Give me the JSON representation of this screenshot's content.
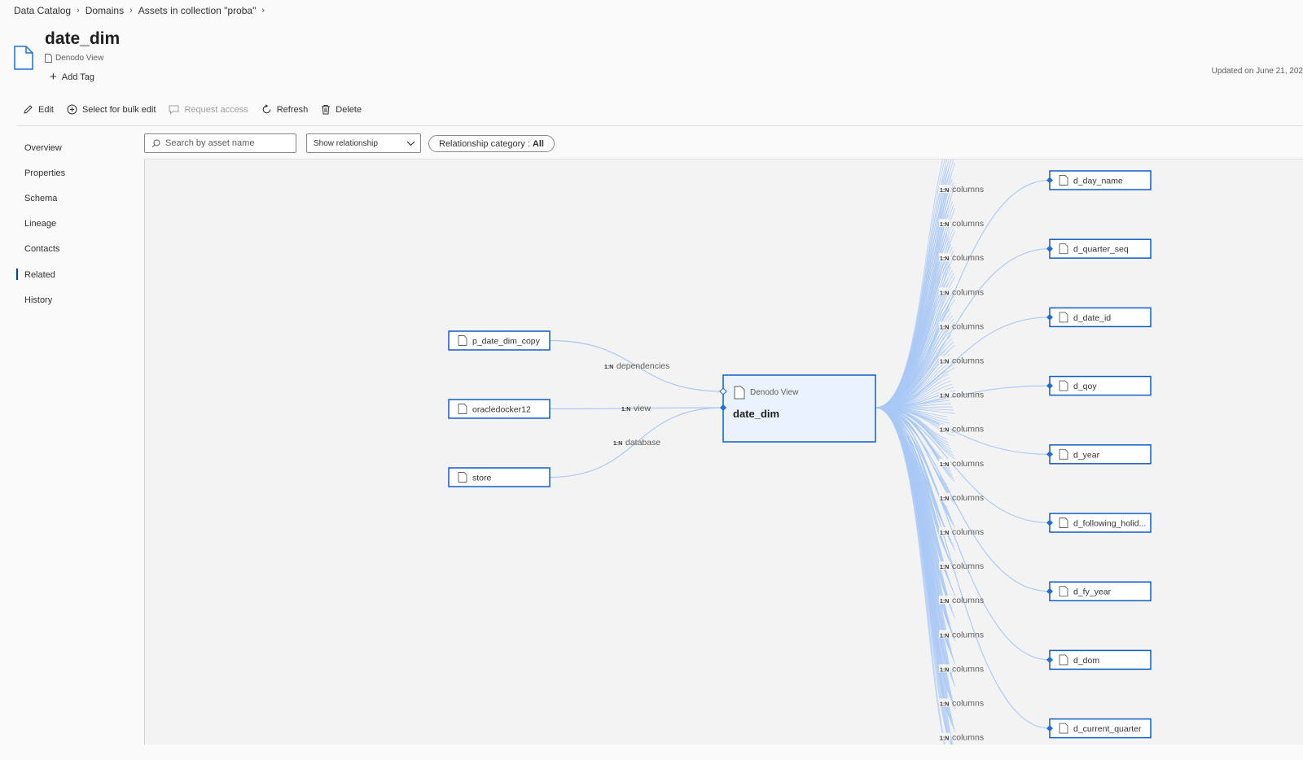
{
  "breadcrumb": [
    "Data Catalog",
    "Domains",
    "Assets in collection \"proba\""
  ],
  "asset": {
    "name": "date_dim",
    "type": "Denodo View"
  },
  "add_tag_label": "Add Tag",
  "updated_text": "Updated on June 21, 202",
  "toolbar": {
    "edit": "Edit",
    "bulk_edit": "Select for bulk edit",
    "request_access": "Request access",
    "refresh": "Refresh",
    "delete": "Delete"
  },
  "nav": {
    "items": [
      "Overview",
      "Properties",
      "Schema",
      "Lineage",
      "Contacts",
      "Related",
      "History"
    ],
    "active": "Related"
  },
  "filters": {
    "search_placeholder": "Search by asset name",
    "show_relationship": "Show relationship",
    "category_label": "Relationship category :",
    "category_value": "All"
  },
  "graph": {
    "center": {
      "type": "Denodo View",
      "name": "date_dim"
    },
    "left_nodes": [
      {
        "name": "p_date_dim_copy",
        "cardinality": "1:N",
        "relation": "dependencies"
      },
      {
        "name": "oracledocker12",
        "cardinality": "1:N",
        "relation": "view"
      },
      {
        "name": "store",
        "cardinality": "1:N",
        "relation": "database"
      }
    ],
    "column_relation": {
      "cardinality": "1:N",
      "label": "columns"
    },
    "right_nodes": [
      "d_day_name",
      "d_quarter_seq",
      "d_date_id",
      "d_qoy",
      "d_year",
      "d_following_holid...",
      "d_fy_year",
      "d_dom",
      "d_current_quarter"
    ],
    "colors": {
      "node_border": "#0f5dc7",
      "edge": "#a9c8f5",
      "center_fill": "#eaf3fd",
      "handle": "#1f6fd6"
    }
  }
}
